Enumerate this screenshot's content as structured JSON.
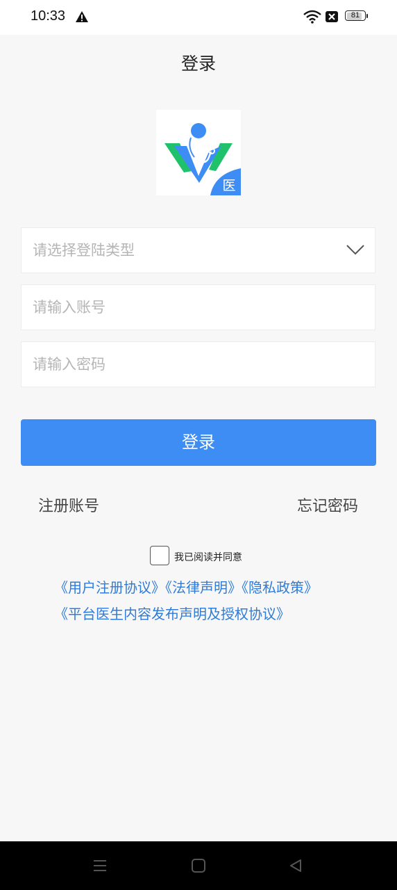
{
  "status_bar": {
    "time": "10:33",
    "battery_level": "81",
    "icons": [
      "warning-icon",
      "wifi-icon",
      "sim-blocked-icon",
      "battery-icon"
    ]
  },
  "header": {
    "title": "登录"
  },
  "logo": {
    "badge_text": "医",
    "colors": {
      "blue": "#3d8df5",
      "green": "#1fc26b"
    }
  },
  "form": {
    "type_select_placeholder": "请选择登陆类型",
    "account_placeholder": "请输入账号",
    "password_placeholder": "请输入密码"
  },
  "login_button": {
    "label": "登录",
    "color": "#3d8df5"
  },
  "links": {
    "register": "注册账号",
    "forgot_password": "忘记密码"
  },
  "agreement": {
    "checked": false,
    "label": "我已阅读并同意",
    "documents": [
      "《用户注册协议》",
      "《法律声明》",
      "《隐私政策》",
      "《平台医生内容发布声明及授权协议》"
    ]
  },
  "nav_bar": {
    "icons": [
      "menu-icon",
      "home-icon",
      "back-icon"
    ]
  }
}
